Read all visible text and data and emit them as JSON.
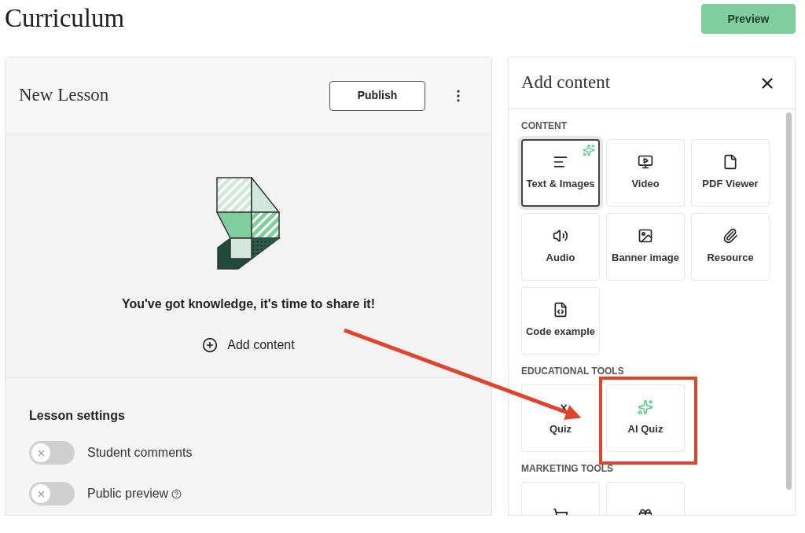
{
  "page": {
    "title": "Curriculum",
    "preview_button": "Preview"
  },
  "lesson": {
    "title": "New Lesson",
    "publish_button": "Publish",
    "empty_message": "You've got knowledge, it's time to share it!",
    "add_content": "Add content",
    "settings_title": "Lesson settings",
    "settings": [
      {
        "label": "Student comments",
        "on": false
      },
      {
        "label": "Public preview",
        "on": false,
        "help": true
      }
    ]
  },
  "panel": {
    "title": "Add content",
    "sections": [
      {
        "heading": "CONTENT",
        "items": [
          {
            "label": "Text & Images",
            "selected": true,
            "ai_badge": true
          },
          {
            "label": "Video",
            "selected": false,
            "ai_badge": false
          },
          {
            "label": "PDF Viewer",
            "selected": false,
            "ai_badge": false
          },
          {
            "label": "Audio",
            "selected": false,
            "ai_badge": false
          },
          {
            "label": "Banner image",
            "selected": false,
            "ai_badge": false
          },
          {
            "label": "Resource",
            "selected": false,
            "ai_badge": false
          },
          {
            "label": "Code example",
            "selected": false,
            "ai_badge": false
          }
        ]
      },
      {
        "heading": "EDUCATIONAL TOOLS",
        "items": [
          {
            "label": "Quiz",
            "selected": false,
            "ai_badge": false
          },
          {
            "label": "AI Quiz",
            "selected": false,
            "ai_badge": false
          }
        ]
      },
      {
        "heading": "MARKETING TOOLS",
        "items": [
          {
            "selected": false,
            "ai_badge": false
          },
          {
            "selected": false,
            "ai_badge": false
          }
        ]
      }
    ]
  },
  "annotation": {
    "highlight": true
  }
}
